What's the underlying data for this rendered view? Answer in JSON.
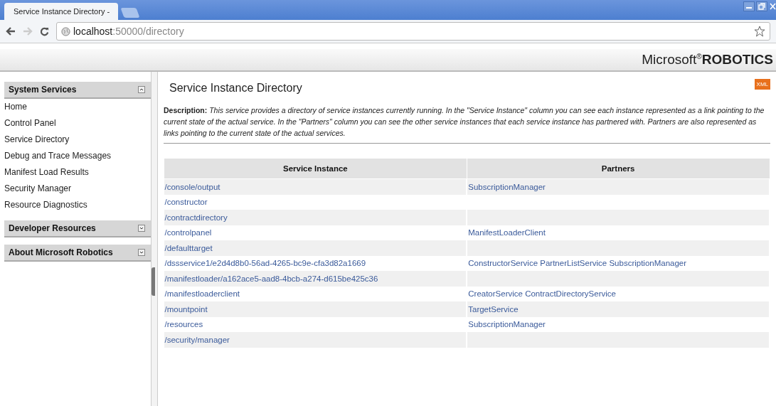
{
  "browser": {
    "tab_title": "Service Instance Directory -",
    "url_host": "localhost",
    "url_path": ":50000/directory"
  },
  "brand": {
    "name": "Microsoft",
    "mark": "®",
    "product": "ROBOTICS"
  },
  "sidebar": [
    {
      "title": "System Services",
      "expanded": true,
      "items": [
        "Home",
        "Control Panel",
        "Service Directory",
        "Debug and Trace Messages",
        "Manifest Load Results",
        "Security Manager",
        "Resource Diagnostics"
      ]
    },
    {
      "title": "Developer Resources",
      "expanded": false
    },
    {
      "title": "About Microsoft Robotics",
      "expanded": false
    }
  ],
  "page": {
    "title": "Service Instance Directory",
    "badge": "XML",
    "description": "**Description:** *This service provides a directory of service instances currently running. In the \"Service Instance\" column you can see each instance represented as a link pointing to the current state of the actual service. In the \"Partners\" column you can see the other service instances that each service instance has partnered with. Partners are also represented as links pointing to the current state of the actual services.*"
  },
  "table": {
    "columns": [
      "Service Instance",
      "Partners"
    ],
    "rows": [
      {
        "instance": "/console/output",
        "partners": [
          "SubscriptionManager"
        ]
      },
      {
        "instance": "/constructor",
        "partners": []
      },
      {
        "instance": "/contractdirectory",
        "partners": []
      },
      {
        "instance": "/controlpanel",
        "partners": [
          "ManifestLoaderClient"
        ]
      },
      {
        "instance": "/defaulttarget",
        "partners": []
      },
      {
        "instance": "/dssservice1/e2d4d8b0-56ad-4265-bc9e-cfa3d82a1669",
        "partners": [
          "ConstructorService",
          "PartnerListService",
          "SubscriptionManager"
        ]
      },
      {
        "instance": "/manifestloader/a162ace5-aad8-4bcb-a274-d615be425c36",
        "partners": []
      },
      {
        "instance": "/manifestloaderclient",
        "partners": [
          "CreatorService",
          "ContractDirectoryService"
        ]
      },
      {
        "instance": "/mountpoint",
        "partners": [
          "TargetService"
        ]
      },
      {
        "instance": "/resources",
        "partners": [
          "SubscriptionManager"
        ]
      },
      {
        "instance": "/security/manager",
        "partners": []
      }
    ]
  }
}
